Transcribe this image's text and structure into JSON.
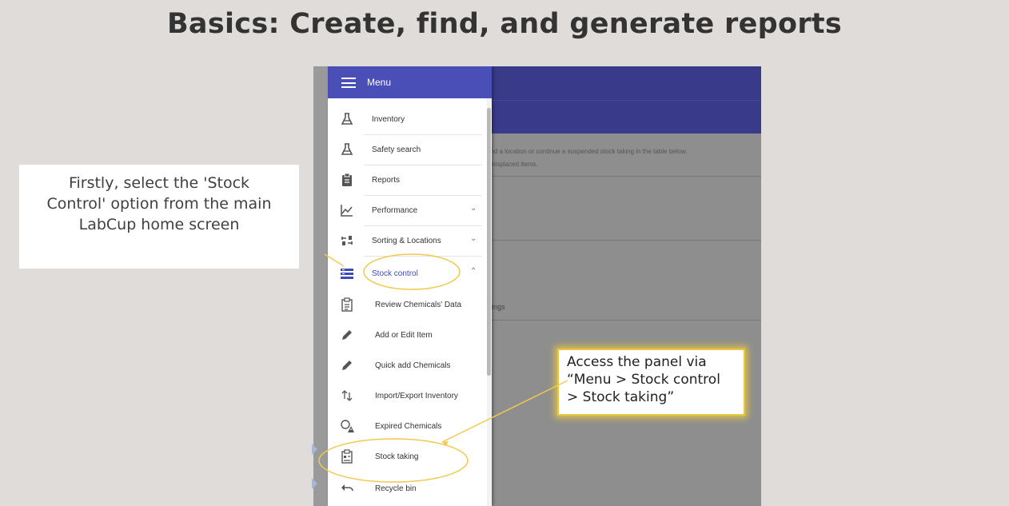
{
  "slide": {
    "title": "Basics: Create, find, and generate reports"
  },
  "left_callout": {
    "lines": [
      "Firstly, select the 'Stock",
      "Control' option from the main",
      "LabCup home screen"
    ]
  },
  "right_callout": {
    "lines": [
      "Access the panel via",
      "“Menu > Stock control",
      "> Stock taking”"
    ]
  },
  "background_page": {
    "line1": "and a location or continue a suspended stock taking in the table below.",
    "line2": "l misplaced items.",
    "tab_fragment": "ings"
  },
  "menu": {
    "title": "Menu",
    "items": [
      {
        "label": "Inventory",
        "icon": "flask-icon"
      },
      {
        "label": "Safety search",
        "icon": "flask-icon"
      },
      {
        "label": "Reports",
        "icon": "clipboard-icon"
      },
      {
        "label": "Performance",
        "icon": "chart-icon",
        "chevron": "⌄"
      },
      {
        "label": "Sorting & Locations",
        "icon": "sorting-icon",
        "chevron": "⌄"
      },
      {
        "label": "Stock control",
        "icon": "stock-control-icon",
        "chevron": "⌃"
      }
    ],
    "sub_items": [
      {
        "label": "Review Chemicals' Data",
        "icon": "clipboard-list-icon"
      },
      {
        "label": "Add or Edit Item",
        "icon": "pencil-icon"
      },
      {
        "label": "Quick add Chemicals",
        "icon": "pencil-icon"
      },
      {
        "label": "Import/Export Inventory",
        "icon": "import-export-icon"
      },
      {
        "label": "Expired Chemicals",
        "icon": "expired-icon"
      },
      {
        "label": "Stock taking",
        "icon": "stock-taking-icon"
      },
      {
        "label": "Recycle bin",
        "icon": "undo-icon"
      }
    ]
  },
  "colors": {
    "menu_header": "#4a4fb8",
    "active_text": "#3d49b8",
    "highlight": "#f2c94c",
    "slide_bg": "#dfdcda"
  }
}
